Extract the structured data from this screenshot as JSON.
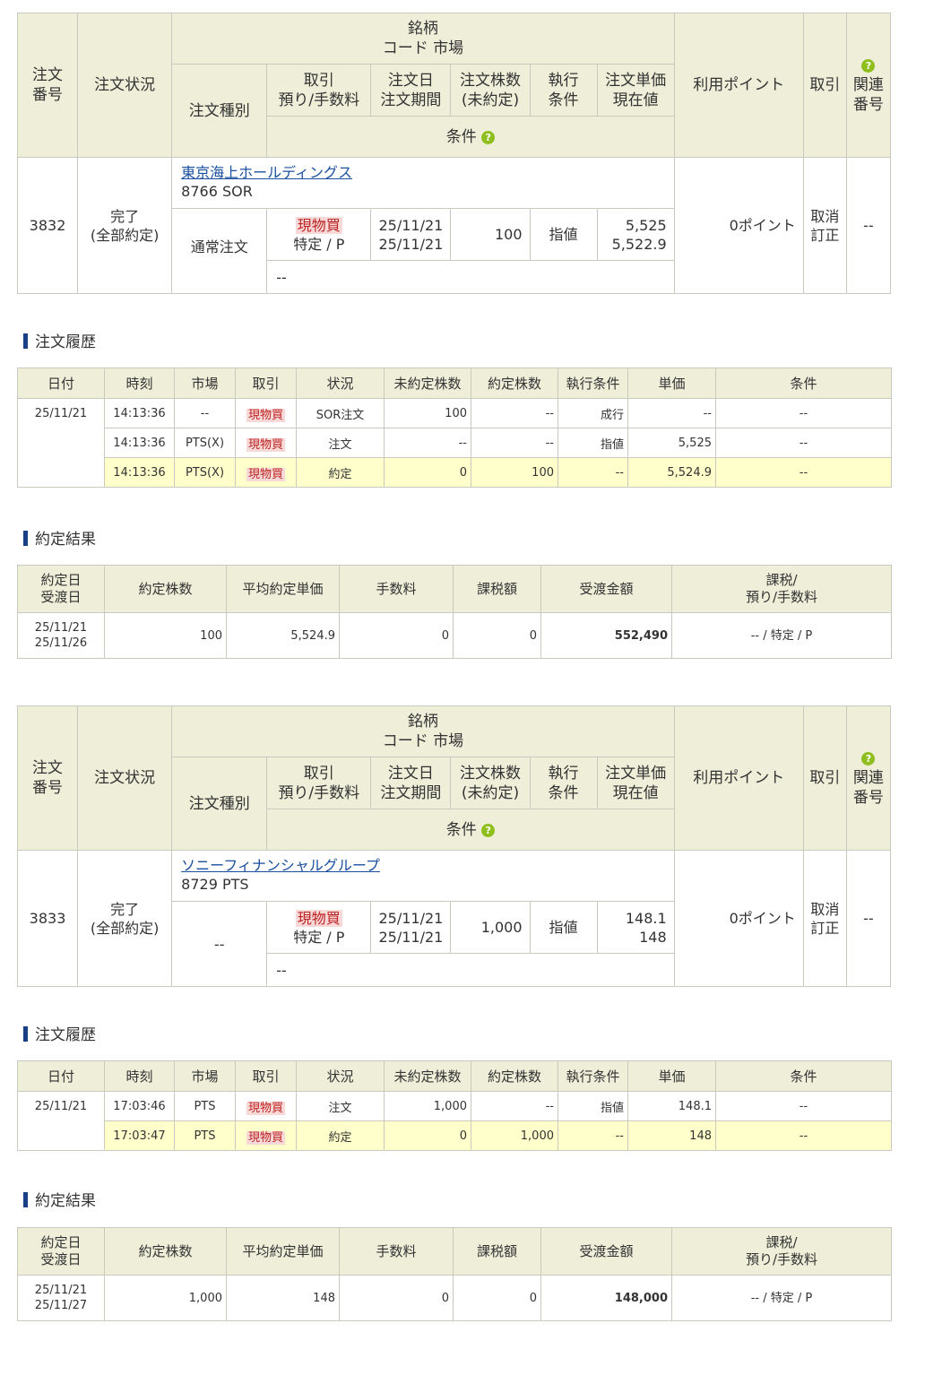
{
  "order_header": {
    "order_no": "注文\n番号",
    "status": "注文状況",
    "brand": "銘柄",
    "code_market": "コード 市場",
    "order_type": "注文種別",
    "trade_fee": "取引\n預り/手数料",
    "order_date": "注文日\n注文期間",
    "shares": "注文株数\n(未約定)",
    "exec_cond": "執行\n条件",
    "unit_price": "注文単価\n現在値",
    "condition": "条件",
    "points": "利用ポイント",
    "trade": "取引",
    "related": "関連\n番号"
  },
  "history_title": "注文履歴",
  "result_title": "約定結果",
  "history_headers": [
    "日付",
    "時刻",
    "市場",
    "取引",
    "状況",
    "未約定株数",
    "約定株数",
    "執行条件",
    "単価",
    "条件"
  ],
  "result_headers": [
    "約定日\n受渡日",
    "約定株数",
    "平均約定単価",
    "手数料",
    "課税額",
    "受渡金額",
    "課税/\n預り/手数料"
  ],
  "orders": [
    {
      "order_no": "3832",
      "status": "完了\n(全部約定)",
      "name": "東京海上ホールディングス",
      "code_market": "8766 SOR",
      "order_type": "通常注文",
      "trade_badge": "現物買",
      "trade_sub": "特定 / P",
      "dates": "25/11/21\n25/11/21",
      "shares": "100",
      "exec": "指値",
      "price": "5,525\n5,522.9",
      "condition": "--",
      "points": "0ポイント",
      "actions": "取消\n訂正",
      "related": "--",
      "history_date": "25/11/21",
      "history": [
        {
          "time": "14:13:36",
          "market": "--",
          "trade": "現物買",
          "status": "SOR注文",
          "unfilled": "100",
          "filled": "--",
          "exec": "成行",
          "price": "--",
          "cond": "--"
        },
        {
          "time": "14:13:36",
          "market": "PTS(X)",
          "trade": "現物買",
          "status": "注文",
          "unfilled": "--",
          "filled": "--",
          "exec": "指値",
          "price": "5,525",
          "cond": "--"
        },
        {
          "time": "14:13:36",
          "market": "PTS(X)",
          "trade": "現物買",
          "status": "約定",
          "unfilled": "0",
          "filled": "100",
          "exec": "--",
          "price": "5,524.9",
          "cond": "--"
        }
      ],
      "result": {
        "dates": "25/11/21\n25/11/26",
        "shares": "100",
        "avg": "5,524.9",
        "fee": "0",
        "tax": "0",
        "amount": "552,490",
        "acct": "-- / 特定 / P"
      }
    },
    {
      "order_no": "3833",
      "status": "完了\n(全部約定)",
      "name": "ソニーフィナンシャルグループ",
      "code_market": "8729 PTS",
      "order_type": "--",
      "trade_badge": "現物買",
      "trade_sub": "特定 / P",
      "dates": "25/11/21\n25/11/21",
      "shares": "1,000",
      "exec": "指値",
      "price": "148.1\n148",
      "condition": "--",
      "points": "0ポイント",
      "actions": "取消\n訂正",
      "related": "--",
      "history_date": "25/11/21",
      "history": [
        {
          "time": "17:03:46",
          "market": "PTS",
          "trade": "現物買",
          "status": "注文",
          "unfilled": "1,000",
          "filled": "--",
          "exec": "指値",
          "price": "148.1",
          "cond": "--"
        },
        {
          "time": "17:03:47",
          "market": "PTS",
          "trade": "現物買",
          "status": "約定",
          "unfilled": "0",
          "filled": "1,000",
          "exec": "--",
          "price": "148",
          "cond": "--"
        }
      ],
      "result": {
        "dates": "25/11/21\n25/11/27",
        "shares": "1,000",
        "avg": "148",
        "fee": "0",
        "tax": "0",
        "amount": "148,000",
        "acct": "-- / 特定 / P"
      }
    }
  ],
  "colors": {
    "header_bg": "#eeeed9",
    "highlight_row": "#ffffcc",
    "badge_bg": "#f9d8d8",
    "link": "#1a4fa0",
    "section_bar": "#1a3f87",
    "help_icon": "#8fbf1f"
  }
}
